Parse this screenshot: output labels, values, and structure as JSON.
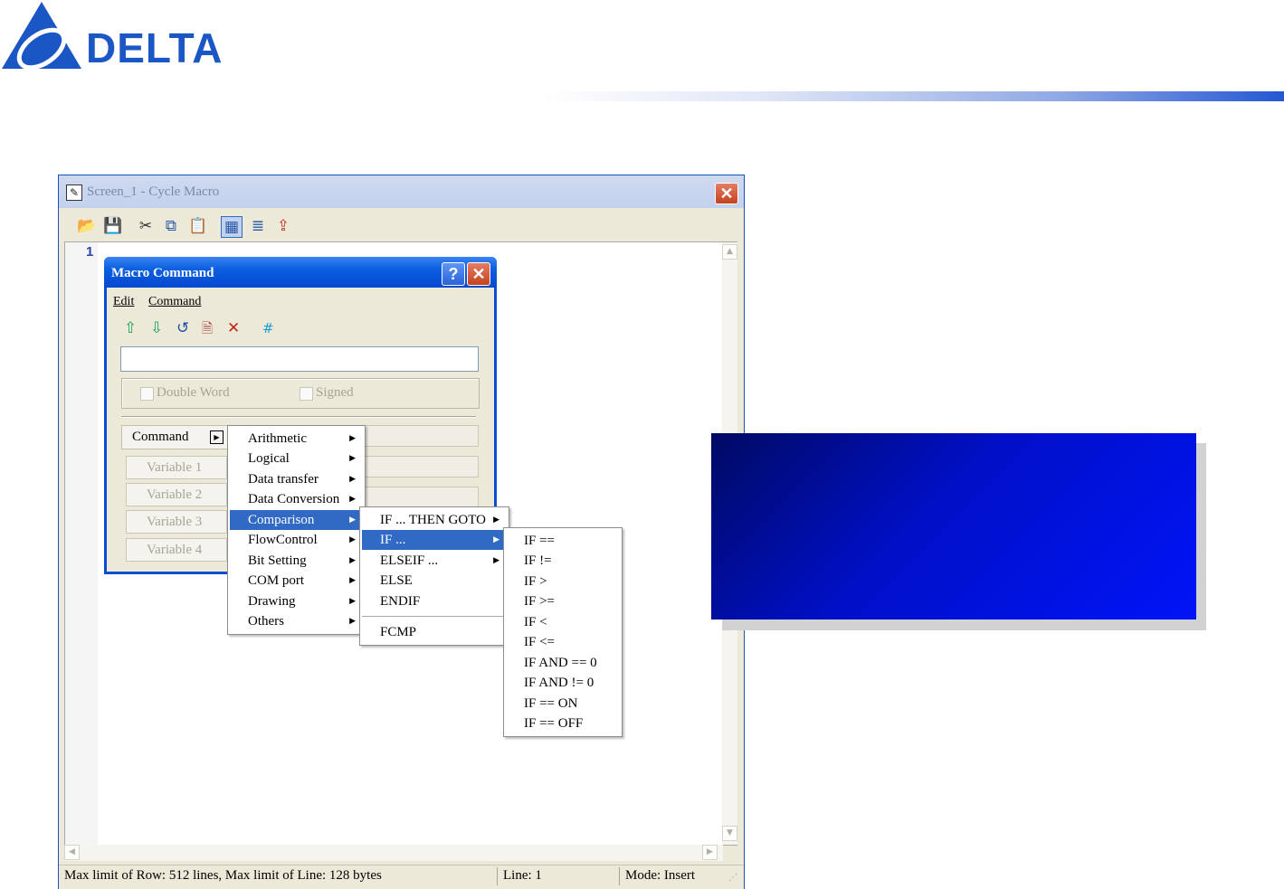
{
  "brand": {
    "name": "DELTA"
  },
  "window": {
    "title": "Screen_1 - Cycle Macro",
    "line_number": "1",
    "status": {
      "limits": "Max limit of Row: 512 lines, Max limit of Line: 128 bytes",
      "line": "Line: 1",
      "mode": "Mode: Insert"
    },
    "toolbar_icons": [
      "open-icon",
      "save-icon",
      "cut-icon",
      "copy-icon",
      "paste-icon",
      "macro-command-icon",
      "insert-icon",
      "export-icon"
    ]
  },
  "dialog": {
    "title": "Macro Command",
    "help_glyph": "?",
    "close_glyph": "✕",
    "menu": [
      "Edit",
      "Command"
    ],
    "toolbar_icons": [
      "move-up-icon",
      "move-down-icon",
      "undo-icon",
      "new-icon",
      "delete-icon",
      "hash-icon"
    ],
    "hash_label": "#",
    "command_input_value": "",
    "options": {
      "double_word": "Double Word",
      "signed": "Signed",
      "double_word_checked": false,
      "signed_checked": false
    },
    "command_button": "Command",
    "variables": [
      "Variable 1",
      "Variable 2",
      "Variable 3",
      "Variable 4"
    ]
  },
  "menu_level1": [
    "Arithmetic",
    "Logical",
    "Data transfer",
    "Data Conversion",
    "Comparison",
    "FlowControl",
    "Bit Setting",
    "COM port",
    "Drawing",
    "Others"
  ],
  "menu_level1_selected": "Comparison",
  "menu_level2": [
    "IF ... THEN GOTO",
    "IF ...",
    "ELSEIF ...",
    "ELSE",
    "ENDIF",
    "FCMP"
  ],
  "menu_level2_selected": "IF ...",
  "menu_level3": [
    "IF ==",
    "IF !=",
    "IF >",
    "IF >=",
    "IF <",
    "IF <=",
    "IF AND == 0",
    "IF AND != 0",
    "IF == ON",
    "IF == OFF"
  ],
  "colors": {
    "brand_blue": "#1a56c4",
    "box_blue": "#0014f8",
    "selection": "#316ac5"
  }
}
